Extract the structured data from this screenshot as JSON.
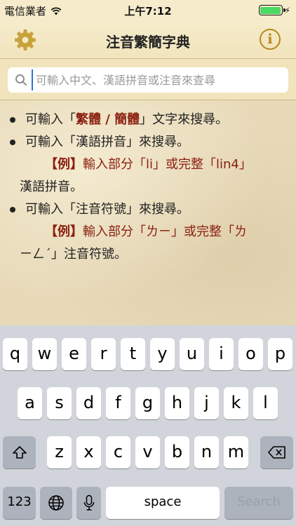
{
  "status_bar": {
    "carrier": "電信業者",
    "time": "上午7:12",
    "battery_color": "#4cd964"
  },
  "nav": {
    "title": "注音繁簡字典",
    "left_icon": "gear-icon",
    "right_icon": "info-icon",
    "info_glyph": "i",
    "accent": "#b8861c"
  },
  "search": {
    "placeholder": "可輸入中文、漢語拼音或注音來查尋",
    "value": ""
  },
  "help": {
    "line1_pre": "可輸入「",
    "line1_em": "繁體 / 簡體",
    "line1_post": "」文字來搜尋。",
    "line2": "可輸入「漢語拼音」來搜尋。",
    "ex1_tag": "【例】",
    "ex1_text": "輸入部分「li」或完整「lin4」",
    "ex1_cont": "漢語拼音。",
    "line3": "可輸入「注音符號」來搜尋。",
    "ex2_tag": "【例】",
    "ex2_text": "輸入部分「ㄌㄧ」或完整「ㄌ",
    "ex2_cont": "ㄧㄥˊ」注音符號。",
    "accent": "#8a1f0f"
  },
  "keyboard": {
    "row1": [
      "q",
      "w",
      "e",
      "r",
      "t",
      "y",
      "u",
      "i",
      "o",
      "p"
    ],
    "row2": [
      "a",
      "s",
      "d",
      "f",
      "g",
      "h",
      "j",
      "k",
      "l"
    ],
    "row3": [
      "z",
      "x",
      "c",
      "v",
      "b",
      "n",
      "m"
    ],
    "numbers_label": "123",
    "space_label": "space",
    "search_label": "Search",
    "shift_icon": "shift-icon",
    "delete_icon": "delete-icon",
    "globe_icon": "globe-icon",
    "mic_icon": "microphone-icon"
  }
}
